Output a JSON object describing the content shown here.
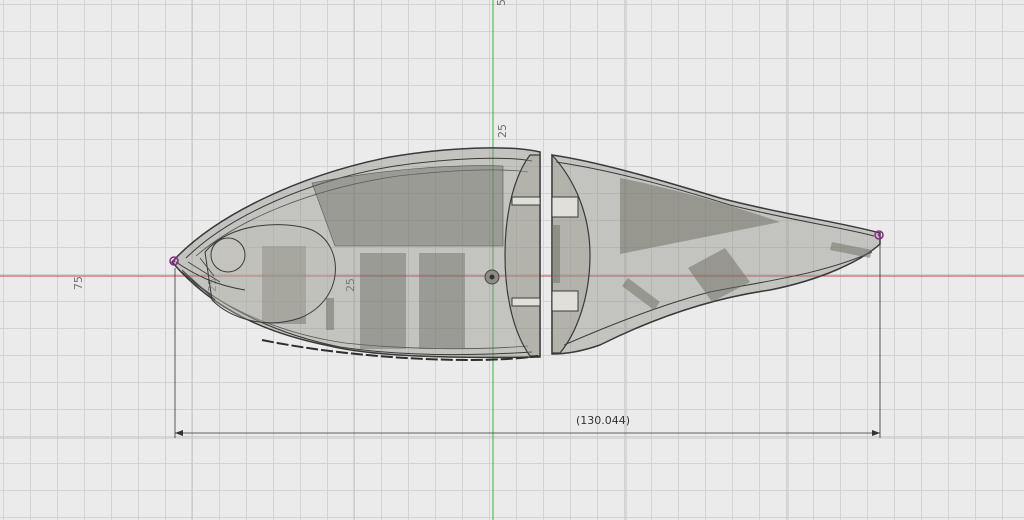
{
  "viewport": {
    "background": "#ebebeb",
    "grid_color": "#d3d3d3",
    "x_axis_color": "#cc4444",
    "y_axis_color": "#3cb43c",
    "body_color": "#8a8a80",
    "outline_color": "#3a3a3a"
  },
  "ruler_labels": {
    "left": "75",
    "top_partial": "5",
    "upper": "25",
    "middle": "25",
    "small": "25"
  },
  "dimension": {
    "value_text": "(130.044)"
  },
  "sketch_points": {
    "color": "#8a2a8a"
  }
}
